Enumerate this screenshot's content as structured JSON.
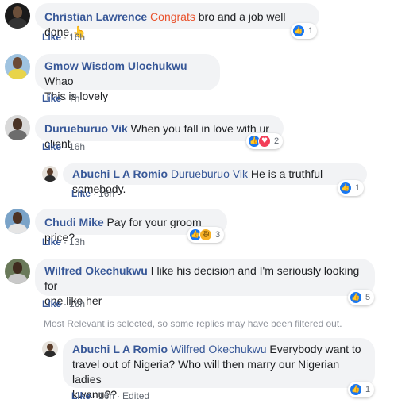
{
  "actions": {
    "like": "Like",
    "separator": "·"
  },
  "notice": "Most Relevant is selected, so some replies may have been filtered out.",
  "comments": [
    {
      "author": "Christian Lawrence",
      "mention": "Congrats",
      "text": " bro and a job well done ",
      "emoji": "👆",
      "time": "16h",
      "reactions": [
        "like"
      ],
      "reaction_count": "1"
    },
    {
      "author": "Gmow Wisdom Ulochukwu",
      "text_line1": " Whao",
      "text_line2": "This is lovely",
      "time": "7h"
    },
    {
      "author": "Durueburuo Vik",
      "text": " When you fall in love with ur client",
      "time": "16h",
      "reactions": [
        "like",
        "love"
      ],
      "reaction_count": "2"
    },
    {
      "author": "Abuchi L A Romio",
      "mention": "Durueburuo Vik",
      "text": " He is a truthful somebody.",
      "time": "16h",
      "reactions": [
        "like"
      ],
      "reaction_count": "1"
    },
    {
      "author": "Chudi Mike",
      "text": " Pay for your groom price?",
      "time": "13h",
      "reactions": [
        "like",
        "haha"
      ],
      "reaction_count": "3"
    },
    {
      "author": "Wilfred Okechukwu",
      "text_line1": " I like his decision and I'm seriously looking for",
      "text_line2": "one like her",
      "time": "16h",
      "reactions": [
        "like"
      ],
      "reaction_count": "5"
    },
    {
      "author": "Abuchi L A Romio",
      "mention": "Wilfred Okechukwu",
      "text_line1": " Everybody want to",
      "text_line2": "travel out of Nigeria? Who will then marry our Nigerian ladies",
      "text_line3": "kwanu??",
      "time": "16h",
      "edited": "Edited",
      "reactions": [
        "like"
      ],
      "reaction_count": "1"
    }
  ]
}
